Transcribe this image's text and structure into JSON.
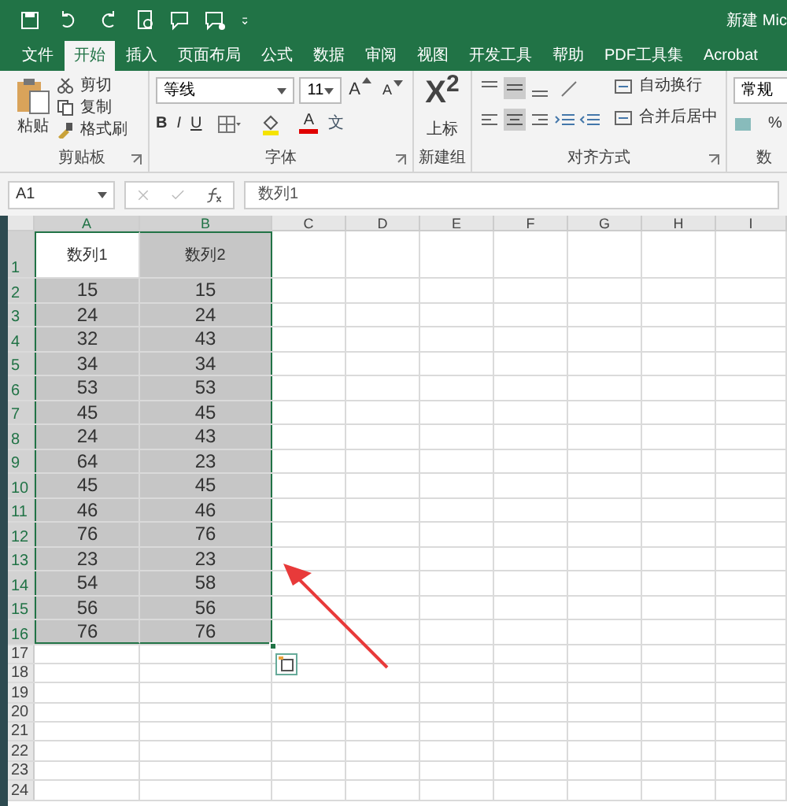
{
  "window": {
    "title": "新建 Mic"
  },
  "tabs": [
    {
      "label": "文件",
      "selected": false
    },
    {
      "label": "开始",
      "selected": true
    },
    {
      "label": "插入",
      "selected": false
    },
    {
      "label": "页面布局",
      "selected": false
    },
    {
      "label": "公式",
      "selected": false
    },
    {
      "label": "数据",
      "selected": false
    },
    {
      "label": "审阅",
      "selected": false
    },
    {
      "label": "视图",
      "selected": false
    },
    {
      "label": "开发工具",
      "selected": false
    },
    {
      "label": "帮助",
      "selected": false
    },
    {
      "label": "PDF工具集",
      "selected": false
    },
    {
      "label": "Acrobat",
      "selected": false
    }
  ],
  "ribbon": {
    "groups": [
      {
        "kind": "clipboard",
        "label": "剪贴板",
        "big": "粘贴",
        "items": [
          "剪切",
          "复制",
          "格式刷"
        ]
      },
      {
        "kind": "font",
        "label": "字体",
        "font": "等线",
        "size": "11",
        "grow": "A",
        "shrink": "A",
        "buttons": [
          "B",
          "I",
          "U"
        ],
        "font_color": "A",
        "phonetic": "文"
      },
      {
        "kind": "newgroup",
        "label": "新建组",
        "glyph": "X$^{2}$",
        "big": "上标"
      },
      {
        "kind": "alignment",
        "label": "对齐方式",
        "items": [
          "自动换行",
          "合并后居中"
        ]
      },
      {
        "kind": "number",
        "label": "数",
        "format": "常规",
        "buttons": [
          "%"
        ]
      }
    ]
  },
  "formula_bar": {
    "name_box": "A1",
    "formula": "数列1"
  },
  "sheet": {
    "columns": [
      {
        "label": "A",
        "selected": true
      },
      {
        "label": "B",
        "selected": true
      },
      {
        "label": "C",
        "selected": false
      },
      {
        "label": "D",
        "selected": false
      },
      {
        "label": "E",
        "selected": false
      },
      {
        "label": "F",
        "selected": false
      },
      {
        "label": "G",
        "selected": false
      },
      {
        "label": "H",
        "selected": false
      },
      {
        "label": "I",
        "selected": false
      }
    ],
    "rows": [
      {
        "label": "1",
        "selected": true,
        "cells": [
          {
            "text": "数列1",
            "active": true
          },
          {
            "text": "数列2",
            "active": false
          }
        ]
      },
      {
        "label": "2",
        "selected": true,
        "cells": [
          {
            "text": "15",
            "active": false
          },
          {
            "text": "15",
            "active": false
          }
        ]
      },
      {
        "label": "3",
        "selected": true,
        "cells": [
          {
            "text": "24",
            "active": false
          },
          {
            "text": "24",
            "active": false
          }
        ]
      },
      {
        "label": "4",
        "selected": true,
        "cells": [
          {
            "text": "32",
            "active": false
          },
          {
            "text": "43",
            "active": false
          }
        ]
      },
      {
        "label": "5",
        "selected": true,
        "cells": [
          {
            "text": "34",
            "active": false
          },
          {
            "text": "34",
            "active": false
          }
        ]
      },
      {
        "label": "6",
        "selected": true,
        "cells": [
          {
            "text": "53",
            "active": false
          },
          {
            "text": "53",
            "active": false
          }
        ]
      },
      {
        "label": "7",
        "selected": true,
        "cells": [
          {
            "text": "45",
            "active": false
          },
          {
            "text": "45",
            "active": false
          }
        ]
      },
      {
        "label": "8",
        "selected": true,
        "cells": [
          {
            "text": "24",
            "active": false
          },
          {
            "text": "43",
            "active": false
          }
        ]
      },
      {
        "label": "9",
        "selected": true,
        "cells": [
          {
            "text": "64",
            "active": false
          },
          {
            "text": "23",
            "active": false
          }
        ]
      },
      {
        "label": "10",
        "selected": true,
        "cells": [
          {
            "text": "45",
            "active": false
          },
          {
            "text": "45",
            "active": false
          }
        ]
      },
      {
        "label": "11",
        "selected": true,
        "cells": [
          {
            "text": "46",
            "active": false
          },
          {
            "text": "46",
            "active": false
          }
        ]
      },
      {
        "label": "12",
        "selected": true,
        "cells": [
          {
            "text": "76",
            "active": false
          },
          {
            "text": "76",
            "active": false
          }
        ]
      },
      {
        "label": "13",
        "selected": true,
        "cells": [
          {
            "text": "23",
            "active": false
          },
          {
            "text": "23",
            "active": false
          }
        ]
      },
      {
        "label": "14",
        "selected": true,
        "cells": [
          {
            "text": "54",
            "active": false
          },
          {
            "text": "58",
            "active": false
          }
        ]
      },
      {
        "label": "15",
        "selected": true,
        "cells": [
          {
            "text": "56",
            "active": false
          },
          {
            "text": "56",
            "active": false
          }
        ]
      },
      {
        "label": "16",
        "selected": true,
        "cells": [
          {
            "text": "76",
            "active": false
          },
          {
            "text": "76",
            "active": false
          }
        ]
      },
      {
        "label": "17",
        "selected": false,
        "cells": []
      },
      {
        "label": "18",
        "selected": false,
        "cells": []
      },
      {
        "label": "19",
        "selected": false,
        "cells": []
      },
      {
        "label": "20",
        "selected": false,
        "cells": []
      },
      {
        "label": "21",
        "selected": false,
        "cells": []
      },
      {
        "label": "22",
        "selected": false,
        "cells": []
      },
      {
        "label": "23",
        "selected": false,
        "cells": []
      },
      {
        "label": "24",
        "selected": false,
        "cells": []
      }
    ]
  }
}
